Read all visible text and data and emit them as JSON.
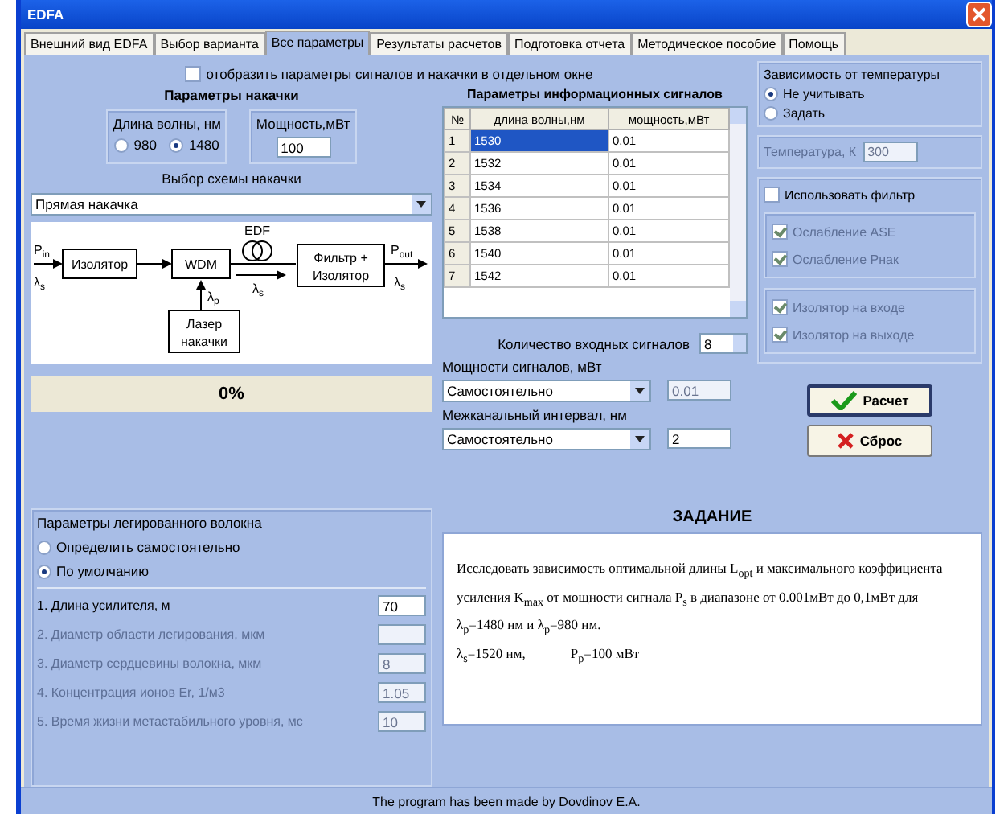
{
  "window": {
    "title": "EDFA"
  },
  "tabs": [
    {
      "label": "Внешний вид EDFA",
      "selected": false
    },
    {
      "label": "Выбор варианта",
      "selected": false
    },
    {
      "label": "Все параметры",
      "selected": true
    },
    {
      "label": "Результаты расчетов",
      "selected": false
    },
    {
      "label": "Подготовка отчета",
      "selected": false
    },
    {
      "label": "Методическое пособие",
      "selected": false
    },
    {
      "label": "Помощь",
      "selected": false
    }
  ],
  "show_separate": {
    "label": "отобразить параметры сигналов и накачки в отдельном окне",
    "checked": false
  },
  "pump": {
    "title": "Параметры накачки",
    "wavelength_label": "Длина волны, нм",
    "wavelengths": [
      {
        "label": "980",
        "selected": false
      },
      {
        "label": "1480",
        "selected": true
      }
    ],
    "power_label": "Мощность,мВт",
    "power": "100",
    "scheme_label": "Выбор схемы накачки",
    "scheme": "Прямая накачка"
  },
  "diagram": {
    "input": "P$_{in}$",
    "input_lambda": "λ$_{s}$",
    "isolator": "Изолятор",
    "wdm": "WDM",
    "fiber": "EDF",
    "fiber_lambda": "λ$_{s}$",
    "pump_lambda": "λ$_{p}$",
    "filter": [
      "Фильтр +",
      "Изолятор"
    ],
    "output": "P$_{out}$",
    "output_lambda": "λ$_{s}$",
    "laser": [
      "Лазер",
      "накачки"
    ]
  },
  "progress": {
    "level": 0,
    "text": "0%"
  },
  "signals": {
    "title": "Параметры информационных сигналов",
    "columns": [
      "№",
      "длина волны,нм",
      "мощность,мВт"
    ],
    "rows": [
      {
        "cells": [
          "1",
          "1530",
          "0.01"
        ],
        "selected": true
      },
      {
        "cells": [
          "2",
          "1532",
          "0.01"
        ],
        "selected": false
      },
      {
        "cells": [
          "3",
          "1534",
          "0.01"
        ],
        "selected": false
      },
      {
        "cells": [
          "4",
          "1536",
          "0.01"
        ],
        "selected": false
      },
      {
        "cells": [
          "5",
          "1538",
          "0.01"
        ],
        "selected": false
      },
      {
        "cells": [
          "6",
          "1540",
          "0.01"
        ],
        "selected": false
      },
      {
        "cells": [
          "7",
          "1542",
          "0.01"
        ],
        "selected": false
      }
    ],
    "count_label": "Количество входных сигналов",
    "count": "8",
    "power_label": "Мощности сигналов, мВт",
    "power_mode": "Самостоятельно",
    "power_value": "0.01",
    "spacing_label": "Межканальный интервал, нм",
    "spacing_mode": "Самостоятельно",
    "spacing_value": "2"
  },
  "temperature": {
    "title": "Зависимость от температуры",
    "options": [
      {
        "label": "Не учитывать",
        "selected": true
      },
      {
        "label": "Задать",
        "selected": false
      }
    ],
    "field_label": "Температура, К",
    "field_value": "300",
    "disabled": true
  },
  "filter": {
    "label": "Использовать фильтр",
    "checked": false,
    "options": [
      {
        "label": "Ослабление ASE",
        "checked": true,
        "disabled": true
      },
      {
        "label": "Ослабление Pнак",
        "checked": true,
        "disabled": true
      },
      {
        "label": "Изолятор на входе",
        "checked": true,
        "disabled": true
      },
      {
        "label": "Изолятор на выходе",
        "checked": true,
        "disabled": true
      }
    ]
  },
  "actions": [
    {
      "kind": "calculate",
      "label": "Расчет"
    },
    {
      "kind": "reset",
      "label": "Сброс"
    }
  ],
  "fiber": {
    "title": "Параметры легированного волокна",
    "modes": [
      {
        "label": "Определить самостоятельно",
        "selected": false
      },
      {
        "label": "По умолчанию",
        "selected": true
      }
    ],
    "params": [
      {
        "label": "1. Длина усилителя, м",
        "value": "70",
        "disabled": false
      },
      {
        "label": "2. Диаметр области легирования, мкм",
        "disabled": true
      },
      {
        "label": "3. Диаметр сердцевины волокна, мкм",
        "value": "8",
        "disabled": true
      },
      {
        "label": "4. Концентрация ионов Er, 1/м3",
        "value": "1.05",
        "disabled": true
      },
      {
        "label": "5. Время жизни метастабильного уровня, мс",
        "value": "10",
        "disabled": true
      }
    ]
  },
  "task": {
    "title": "ЗАДАНИЕ",
    "paragraph": "Исследовать зависимость оптимальной длины L$_{opt}$ и максимального коэффициента усиления K$_{max}$ от мощности сигнала P$_{s}$ в диапазоне от 0.001мВт до 0,1мВт для λ$_{p}$=1480 нм и λ$_{p}$=980 нм.",
    "params": [
      "λ$_{s}$=1520 нм,",
      "P$_{p}$=100 мВт"
    ]
  },
  "status_bar": "The program has been made by Dovdinov E.A."
}
